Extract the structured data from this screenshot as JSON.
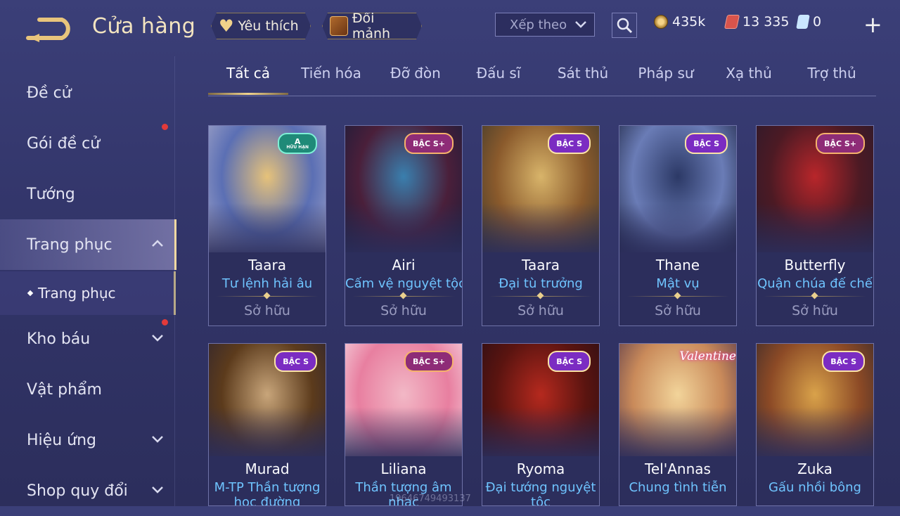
{
  "header": {
    "title": "Cửa hàng",
    "favorites_label": "Yêu thích",
    "exchange_label": "Đổi mảnh",
    "sort_label": "Xếp theo"
  },
  "currencies": {
    "gold": "435k",
    "ruby": "13 335",
    "voucher": "0"
  },
  "sidebar": {
    "items": [
      {
        "label": "Đề cử",
        "dot": false
      },
      {
        "label": "Gói đề cử",
        "dot": true
      },
      {
        "label": "Tướng",
        "dot": false
      },
      {
        "label": "Trang phục",
        "dot": false,
        "active": true
      },
      {
        "label": "Kho báu",
        "dot": true
      },
      {
        "label": "Vật phẩm",
        "dot": false
      },
      {
        "label": "Hiệu ứng",
        "dot": false
      },
      {
        "label": "Shop quy đổi",
        "dot": false
      }
    ],
    "sub_item": "Trang phục"
  },
  "tabs": [
    "Tất cả",
    "Tiến hóa",
    "Đỡ đòn",
    "Đấu sĩ",
    "Sát thủ",
    "Pháp sư",
    "Xạ thủ",
    "Trợ thủ"
  ],
  "active_tab": 0,
  "cards": [
    {
      "hero": "Taara",
      "skin": "Tư lệnh hải âu",
      "status": "Sở hữu",
      "badge": "A",
      "badge_sub": "HỮU HẠN",
      "badge_kind": "a",
      "art": [
        "#e6c27a",
        "#5b6fb4",
        "#a6a8c9"
      ]
    },
    {
      "hero": "Airi",
      "skin": "Cấm vệ nguyệt tộc",
      "status": "Sở hữu",
      "badge": "BẬC S+",
      "badge_kind": "splus",
      "art": [
        "#3a7fae",
        "#4a1f3a",
        "#1a1d3a"
      ]
    },
    {
      "hero": "Taara",
      "skin": "Đại tù trưởng",
      "status": "Sở hữu",
      "badge": "BẬC S",
      "badge_kind": "s",
      "art": [
        "#d8b46a",
        "#8a5a2c",
        "#3f3a2c"
      ]
    },
    {
      "hero": "Thane",
      "skin": "Mật vụ",
      "status": "Sở hữu",
      "badge": "BẬC S",
      "badge_kind": "s",
      "art": [
        "#2c3966",
        "#6a7cb6",
        "#202746"
      ]
    },
    {
      "hero": "Butterfly",
      "skin": "Quận chúa đế chế",
      "status": "Sở hữu",
      "badge": "BẬC S+",
      "badge_kind": "splus",
      "art": [
        "#b8262a",
        "#4c1a24",
        "#2a1a2c"
      ]
    },
    {
      "hero": "Murad",
      "skin": "M-TP Thần tượng học đường",
      "status": "",
      "badge": "BẬC S",
      "badge_kind": "s",
      "art": [
        "#c8a57a",
        "#5c3b1c",
        "#2e2430"
      ]
    },
    {
      "hero": "Liliana",
      "skin": "Thần tượng âm nhạc",
      "status": "",
      "badge": "BẬC S+",
      "badge_kind": "splus",
      "art": [
        "#f2b8c6",
        "#e87fa0",
        "#f6d9e2"
      ]
    },
    {
      "hero": "Ryoma",
      "skin": "Đại tướng nguyệt tộc",
      "status": "",
      "badge": "BẬC S",
      "badge_kind": "s",
      "art": [
        "#b5291e",
        "#5a1410",
        "#2a0e14"
      ]
    },
    {
      "hero": "Tel'Annas",
      "skin": "Chung tình tiễn",
      "status": "",
      "badge": "Valentine",
      "badge_kind": "val",
      "art": [
        "#f2d49a",
        "#c98a5a",
        "#5a3a4a"
      ]
    },
    {
      "hero": "Zuka",
      "skin": "Gấu nhồi bông",
      "status": "",
      "badge": "BẬC S",
      "badge_kind": "s",
      "art": [
        "#d9a24a",
        "#8c4a26",
        "#3a2a2a"
      ]
    }
  ],
  "watermark": "19646749493137",
  "colors": {
    "accent_gold": "#f1d48f",
    "skin_name_blue": "#6fc4ff",
    "notification_red": "#e23a3a"
  }
}
